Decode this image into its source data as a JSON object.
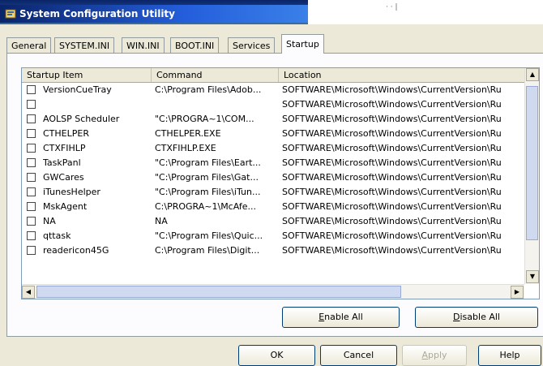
{
  "window": {
    "title": "System Configuration Utility"
  },
  "tabs": [
    {
      "label": "General"
    },
    {
      "label": "SYSTEM.INI"
    },
    {
      "label": "WIN.INI"
    },
    {
      "label": "BOOT.INI"
    },
    {
      "label": "Services"
    },
    {
      "label": "Startup",
      "active": true
    }
  ],
  "list": {
    "columns": {
      "item": "Startup Item",
      "command": "Command",
      "location": "Location"
    },
    "rows": [
      {
        "item": "VersionCueTray",
        "command": "C:\\Program Files\\Adob...",
        "location": "SOFTWARE\\Microsoft\\Windows\\CurrentVersion\\Ru"
      },
      {
        "item": "",
        "command": "",
        "location": "SOFTWARE\\Microsoft\\Windows\\CurrentVersion\\Ru"
      },
      {
        "item": "AOLSP Scheduler",
        "command": "\"C:\\PROGRA~1\\COM...",
        "location": "SOFTWARE\\Microsoft\\Windows\\CurrentVersion\\Ru"
      },
      {
        "item": "CTHELPER",
        "command": "CTHELPER.EXE",
        "location": "SOFTWARE\\Microsoft\\Windows\\CurrentVersion\\Ru"
      },
      {
        "item": "CTXFIHLP",
        "command": "CTXFIHLP.EXE",
        "location": "SOFTWARE\\Microsoft\\Windows\\CurrentVersion\\Ru"
      },
      {
        "item": "TaskPanl",
        "command": "\"C:\\Program Files\\Eart...",
        "location": "SOFTWARE\\Microsoft\\Windows\\CurrentVersion\\Ru"
      },
      {
        "item": "GWCares",
        "command": "\"C:\\Program Files\\Gat...",
        "location": "SOFTWARE\\Microsoft\\Windows\\CurrentVersion\\Ru"
      },
      {
        "item": "iTunesHelper",
        "command": "\"C:\\Program Files\\iTun...",
        "location": "SOFTWARE\\Microsoft\\Windows\\CurrentVersion\\Ru"
      },
      {
        "item": "MskAgent",
        "command": "C:\\PROGRA~1\\McAfe...",
        "location": "SOFTWARE\\Microsoft\\Windows\\CurrentVersion\\Ru"
      },
      {
        "item": "NA",
        "command": "NA",
        "location": "SOFTWARE\\Microsoft\\Windows\\CurrentVersion\\Ru"
      },
      {
        "item": "qttask",
        "command": "\"C:\\Program Files\\Quic...",
        "location": "SOFTWARE\\Microsoft\\Windows\\CurrentVersion\\Ru"
      },
      {
        "item": "readericon45G",
        "command": "C:\\Program Files\\Digit...",
        "location": "SOFTWARE\\Microsoft\\Windows\\CurrentVersion\\Ru"
      }
    ]
  },
  "buttons": {
    "enable_all": {
      "label_accel": "E",
      "label_rest": "nable All"
    },
    "disable_all": {
      "label_accel": "D",
      "label_rest": "isable All"
    },
    "ok": "OK",
    "cancel": "Cancel",
    "apply": {
      "label_accel": "A",
      "label_rest": "pply"
    },
    "help": "Help"
  },
  "colors": {
    "title_bar": "#0a246a",
    "face": "#ece9d8",
    "border": "#919b9c"
  }
}
